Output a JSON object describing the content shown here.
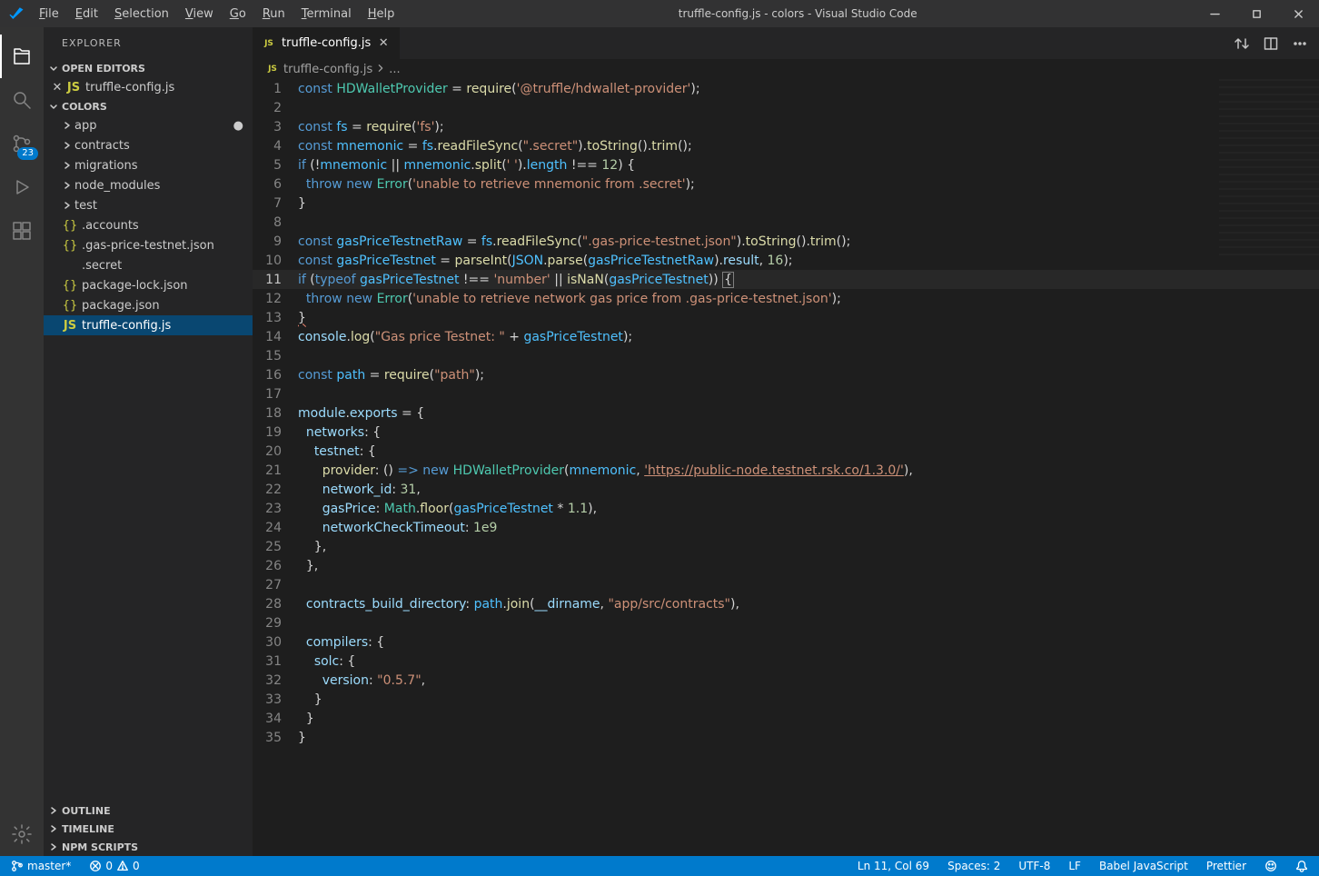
{
  "titlebar": {
    "menus": [
      "File",
      "Edit",
      "Selection",
      "View",
      "Go",
      "Run",
      "Terminal",
      "Help"
    ],
    "title": "truffle-config.js - colors - Visual Studio Code"
  },
  "activity": {
    "scm_badge": "23"
  },
  "sidebar": {
    "header": "EXPLORER",
    "open_editors_label": "OPEN EDITORS",
    "open_editors": [
      "truffle-config.js"
    ],
    "project_label": "COLORS",
    "folders": [
      "app",
      "contracts",
      "migrations",
      "node_modules",
      "test"
    ],
    "files": [
      {
        "name": ".accounts",
        "icon": "json"
      },
      {
        "name": ".gas-price-testnet.json",
        "icon": "json"
      },
      {
        "name": ".secret",
        "icon": "none"
      },
      {
        "name": "package-lock.json",
        "icon": "json"
      },
      {
        "name": "package.json",
        "icon": "json"
      },
      {
        "name": "truffle-config.js",
        "icon": "js"
      }
    ],
    "bottom_sections": [
      "OUTLINE",
      "TIMELINE",
      "NPM SCRIPTS"
    ]
  },
  "tabs": {
    "items": [
      "truffle-config.js"
    ]
  },
  "breadcrumbs": {
    "parts": [
      "truffle-config.js",
      "..."
    ]
  },
  "code": [
    [
      {
        "t": "kw",
        "s": "const"
      },
      {
        "t": "p",
        "s": " "
      },
      {
        "t": "type",
        "s": "HDWalletProvider"
      },
      {
        "t": "p",
        "s": " = "
      },
      {
        "t": "func",
        "s": "require"
      },
      {
        "t": "p",
        "s": "("
      },
      {
        "t": "str",
        "s": "'@truffle/hdwallet-provider'"
      },
      {
        "t": "p",
        "s": ");"
      }
    ],
    [],
    [
      {
        "t": "kw",
        "s": "const"
      },
      {
        "t": "p",
        "s": " "
      },
      {
        "t": "const",
        "s": "fs"
      },
      {
        "t": "p",
        "s": " = "
      },
      {
        "t": "func",
        "s": "require"
      },
      {
        "t": "p",
        "s": "("
      },
      {
        "t": "str",
        "s": "'fs'"
      },
      {
        "t": "p",
        "s": ");"
      }
    ],
    [
      {
        "t": "kw",
        "s": "const"
      },
      {
        "t": "p",
        "s": " "
      },
      {
        "t": "const",
        "s": "mnemonic"
      },
      {
        "t": "p",
        "s": " = "
      },
      {
        "t": "const",
        "s": "fs"
      },
      {
        "t": "p",
        "s": "."
      },
      {
        "t": "func",
        "s": "readFileSync"
      },
      {
        "t": "p",
        "s": "("
      },
      {
        "t": "str",
        "s": "\".secret\""
      },
      {
        "t": "p",
        "s": ")."
      },
      {
        "t": "func",
        "s": "toString"
      },
      {
        "t": "p",
        "s": "()."
      },
      {
        "t": "func",
        "s": "trim"
      },
      {
        "t": "p",
        "s": "();"
      }
    ],
    [
      {
        "t": "kw",
        "s": "if"
      },
      {
        "t": "p",
        "s": " (!"
      },
      {
        "t": "const",
        "s": "mnemonic"
      },
      {
        "t": "p",
        "s": " || "
      },
      {
        "t": "const",
        "s": "mnemonic"
      },
      {
        "t": "p",
        "s": "."
      },
      {
        "t": "func",
        "s": "split"
      },
      {
        "t": "p",
        "s": "("
      },
      {
        "t": "str",
        "s": "' '"
      },
      {
        "t": "p",
        "s": ")."
      },
      {
        "t": "const",
        "s": "length"
      },
      {
        "t": "p",
        "s": " !== "
      },
      {
        "t": "num",
        "s": "12"
      },
      {
        "t": "p",
        "s": ") {"
      }
    ],
    [
      {
        "t": "p",
        "s": "  "
      },
      {
        "t": "kw",
        "s": "throw"
      },
      {
        "t": "p",
        "s": " "
      },
      {
        "t": "kw",
        "s": "new"
      },
      {
        "t": "p",
        "s": " "
      },
      {
        "t": "type",
        "s": "Error"
      },
      {
        "t": "p",
        "s": "("
      },
      {
        "t": "str",
        "s": "'unable to retrieve mnemonic from .secret'"
      },
      {
        "t": "p",
        "s": ");"
      }
    ],
    [
      {
        "t": "p",
        "s": "}"
      }
    ],
    [],
    [
      {
        "t": "kw",
        "s": "const"
      },
      {
        "t": "p",
        "s": " "
      },
      {
        "t": "const",
        "s": "gasPriceTestnetRaw"
      },
      {
        "t": "p",
        "s": " = "
      },
      {
        "t": "const",
        "s": "fs"
      },
      {
        "t": "p",
        "s": "."
      },
      {
        "t": "func",
        "s": "readFileSync"
      },
      {
        "t": "p",
        "s": "("
      },
      {
        "t": "str",
        "s": "\".gas-price-testnet.json\""
      },
      {
        "t": "p",
        "s": ")."
      },
      {
        "t": "func",
        "s": "toString"
      },
      {
        "t": "p",
        "s": "()."
      },
      {
        "t": "func",
        "s": "trim"
      },
      {
        "t": "p",
        "s": "();"
      }
    ],
    [
      {
        "t": "kw",
        "s": "const"
      },
      {
        "t": "p",
        "s": " "
      },
      {
        "t": "const",
        "s": "gasPriceTestnet"
      },
      {
        "t": "p",
        "s": " = "
      },
      {
        "t": "func",
        "s": "parseInt"
      },
      {
        "t": "p",
        "s": "("
      },
      {
        "t": "const",
        "s": "JSON"
      },
      {
        "t": "p",
        "s": "."
      },
      {
        "t": "func",
        "s": "parse"
      },
      {
        "t": "p",
        "s": "("
      },
      {
        "t": "const",
        "s": "gasPriceTestnetRaw"
      },
      {
        "t": "p",
        "s": ")."
      },
      {
        "t": "var",
        "s": "result"
      },
      {
        "t": "p",
        "s": ", "
      },
      {
        "t": "num",
        "s": "16"
      },
      {
        "t": "p",
        "s": ");"
      }
    ],
    [
      {
        "t": "kw",
        "s": "if"
      },
      {
        "t": "p",
        "s": " ("
      },
      {
        "t": "kw",
        "s": "typeof"
      },
      {
        "t": "p",
        "s": " "
      },
      {
        "t": "const",
        "s": "gasPriceTestnet"
      },
      {
        "t": "p",
        "s": " !== "
      },
      {
        "t": "str",
        "s": "'number'"
      },
      {
        "t": "p",
        "s": " || "
      },
      {
        "t": "func",
        "s": "isNaN"
      },
      {
        "t": "p",
        "s": "("
      },
      {
        "t": "const",
        "s": "gasPriceTestnet"
      },
      {
        "t": "p",
        "s": ")) "
      },
      {
        "t": "cursor",
        "s": "{"
      }
    ],
    [
      {
        "t": "p",
        "s": "  "
      },
      {
        "t": "kw",
        "s": "throw"
      },
      {
        "t": "p",
        "s": " "
      },
      {
        "t": "kw",
        "s": "new"
      },
      {
        "t": "p",
        "s": " "
      },
      {
        "t": "type",
        "s": "Error"
      },
      {
        "t": "p",
        "s": "("
      },
      {
        "t": "str",
        "s": "'unable to retrieve network gas price from .gas-price-testnet.json'"
      },
      {
        "t": "p",
        "s": ");"
      }
    ],
    [
      {
        "t": "sq",
        "s": "}"
      }
    ],
    [
      {
        "t": "var",
        "s": "console"
      },
      {
        "t": "p",
        "s": "."
      },
      {
        "t": "func",
        "s": "log"
      },
      {
        "t": "p",
        "s": "("
      },
      {
        "t": "str",
        "s": "\"Gas price Testnet: \""
      },
      {
        "t": "p",
        "s": " + "
      },
      {
        "t": "const",
        "s": "gasPriceTestnet"
      },
      {
        "t": "p",
        "s": ");"
      }
    ],
    [],
    [
      {
        "t": "kw",
        "s": "const"
      },
      {
        "t": "p",
        "s": " "
      },
      {
        "t": "const",
        "s": "path"
      },
      {
        "t": "p",
        "s": " = "
      },
      {
        "t": "func",
        "s": "require"
      },
      {
        "t": "p",
        "s": "("
      },
      {
        "t": "str",
        "s": "\"path\""
      },
      {
        "t": "p",
        "s": ");"
      }
    ],
    [],
    [
      {
        "t": "var",
        "s": "module"
      },
      {
        "t": "p",
        "s": "."
      },
      {
        "t": "var",
        "s": "exports"
      },
      {
        "t": "p",
        "s": " = {"
      }
    ],
    [
      {
        "t": "p",
        "s": "  "
      },
      {
        "t": "prop",
        "s": "networks"
      },
      {
        "t": "p",
        "s": ": {"
      }
    ],
    [
      {
        "t": "p",
        "s": "    "
      },
      {
        "t": "prop",
        "s": "testnet"
      },
      {
        "t": "p",
        "s": ": {"
      }
    ],
    [
      {
        "t": "p",
        "s": "      "
      },
      {
        "t": "func",
        "s": "provider"
      },
      {
        "t": "p",
        "s": ": () "
      },
      {
        "t": "kw",
        "s": "=>"
      },
      {
        "t": "p",
        "s": " "
      },
      {
        "t": "kw",
        "s": "new"
      },
      {
        "t": "p",
        "s": " "
      },
      {
        "t": "type",
        "s": "HDWalletProvider"
      },
      {
        "t": "p",
        "s": "("
      },
      {
        "t": "const",
        "s": "mnemonic"
      },
      {
        "t": "p",
        "s": ", "
      },
      {
        "t": "url",
        "s": "'https://public-node.testnet.rsk.co/1.3.0/'"
      },
      {
        "t": "p",
        "s": "),"
      }
    ],
    [
      {
        "t": "p",
        "s": "      "
      },
      {
        "t": "prop",
        "s": "network_id"
      },
      {
        "t": "p",
        "s": ": "
      },
      {
        "t": "num",
        "s": "31"
      },
      {
        "t": "p",
        "s": ","
      }
    ],
    [
      {
        "t": "p",
        "s": "      "
      },
      {
        "t": "prop",
        "s": "gasPrice"
      },
      {
        "t": "p",
        "s": ": "
      },
      {
        "t": "type",
        "s": "Math"
      },
      {
        "t": "p",
        "s": "."
      },
      {
        "t": "func",
        "s": "floor"
      },
      {
        "t": "p",
        "s": "("
      },
      {
        "t": "const",
        "s": "gasPriceTestnet"
      },
      {
        "t": "p",
        "s": " * "
      },
      {
        "t": "num",
        "s": "1.1"
      },
      {
        "t": "p",
        "s": "),"
      }
    ],
    [
      {
        "t": "p",
        "s": "      "
      },
      {
        "t": "prop",
        "s": "networkCheckTimeout"
      },
      {
        "t": "p",
        "s": ": "
      },
      {
        "t": "num",
        "s": "1e9"
      }
    ],
    [
      {
        "t": "p",
        "s": "    },"
      }
    ],
    [
      {
        "t": "p",
        "s": "  },"
      }
    ],
    [],
    [
      {
        "t": "p",
        "s": "  "
      },
      {
        "t": "prop",
        "s": "contracts_build_directory"
      },
      {
        "t": "p",
        "s": ": "
      },
      {
        "t": "const",
        "s": "path"
      },
      {
        "t": "p",
        "s": "."
      },
      {
        "t": "func",
        "s": "join"
      },
      {
        "t": "p",
        "s": "("
      },
      {
        "t": "var",
        "s": "__dirname"
      },
      {
        "t": "p",
        "s": ", "
      },
      {
        "t": "str",
        "s": "\"app/src/contracts\""
      },
      {
        "t": "p",
        "s": "),"
      }
    ],
    [],
    [
      {
        "t": "p",
        "s": "  "
      },
      {
        "t": "prop",
        "s": "compilers"
      },
      {
        "t": "p",
        "s": ": {"
      }
    ],
    [
      {
        "t": "p",
        "s": "    "
      },
      {
        "t": "prop",
        "s": "solc"
      },
      {
        "t": "p",
        "s": ": {"
      }
    ],
    [
      {
        "t": "p",
        "s": "      "
      },
      {
        "t": "prop",
        "s": "version"
      },
      {
        "t": "p",
        "s": ": "
      },
      {
        "t": "str",
        "s": "\"0.5.7\""
      },
      {
        "t": "p",
        "s": ","
      }
    ],
    [
      {
        "t": "p",
        "s": "    }"
      }
    ],
    [
      {
        "t": "p",
        "s": "  }"
      }
    ],
    [
      {
        "t": "p",
        "s": "}"
      }
    ]
  ],
  "code_highlight_line": 11,
  "statusbar": {
    "branch": "master*",
    "errors": "0",
    "warnings": "0",
    "line_col": "Ln 11, Col 69",
    "spaces": "Spaces: 2",
    "encoding": "UTF-8",
    "eol": "LF",
    "language": "Babel JavaScript",
    "formatter": "Prettier"
  }
}
